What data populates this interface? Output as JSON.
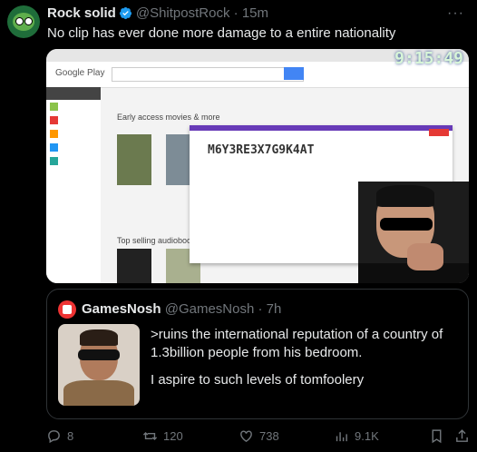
{
  "author": {
    "name": "Rock solid",
    "handle": "@ShitpostRock",
    "time": "15m",
    "verified": true,
    "text": "No clip has ever done more damage to a entire nationality"
  },
  "media": {
    "clock": "9:15:49",
    "logo": "Google Play",
    "section_title": "Early access movies & more",
    "section_title_2": "Top selling audiobooks",
    "code": "M6Y3RE3X7G9K4AT",
    "accent": "#673ab7"
  },
  "quote": {
    "name": "GamesNosh",
    "handle": "@GamesNosh",
    "time": "7h",
    "line1": ">ruins the international reputation of a country of 1.3billion people from his bedroom.",
    "line2": "I aspire to such levels of tomfoolery"
  },
  "actions": {
    "replies": "8",
    "reposts": "120",
    "likes": "738",
    "views": "9.1K"
  },
  "colors": {
    "background": "#000000",
    "text": "#e7e9ea",
    "muted": "#71767b",
    "verified": "#1d9bf0",
    "border": "#2f3336"
  }
}
